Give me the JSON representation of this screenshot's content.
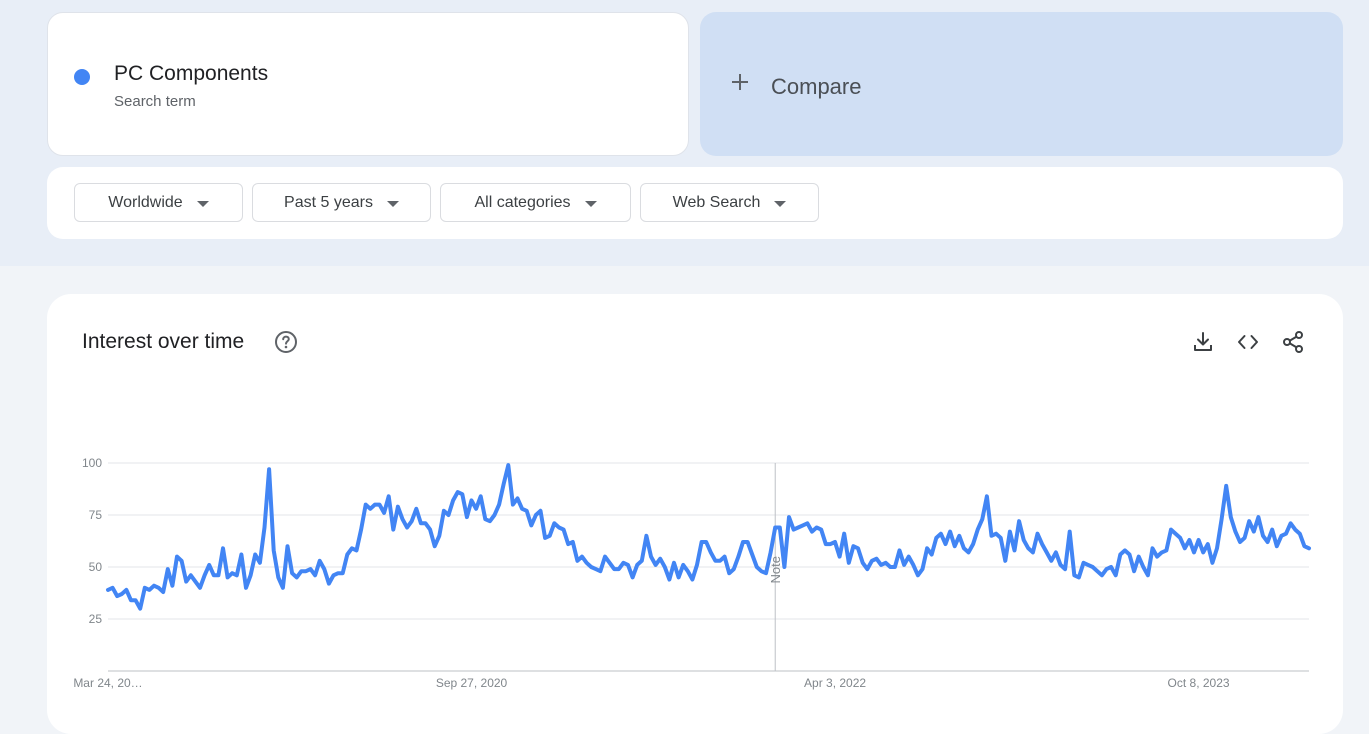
{
  "term": {
    "name": "PC Components",
    "subtitle": "Search term",
    "dot_color": "#4285f4"
  },
  "compare": {
    "label": "Compare",
    "icon": "plus-icon"
  },
  "filters": [
    {
      "label": "Worldwide",
      "icon": "caret-down-icon"
    },
    {
      "label": "Past 5 years",
      "icon": "caret-down-icon"
    },
    {
      "label": "All categories",
      "icon": "caret-down-icon"
    },
    {
      "label": "Web Search",
      "icon": "caret-down-icon"
    }
  ],
  "panel": {
    "title": "Interest over time",
    "icons": [
      "help-icon",
      "download-icon",
      "embed-code-icon",
      "share-icon"
    ]
  },
  "chart_data": {
    "type": "line",
    "series": [
      {
        "color": "#4285f4",
        "values": [
          39,
          40,
          36,
          37,
          39,
          34,
          34,
          30,
          40,
          39,
          41,
          40,
          38,
          49,
          41,
          55,
          53,
          43,
          46,
          43,
          40,
          46,
          51,
          46,
          46,
          59,
          45,
          47,
          46,
          56,
          40,
          46,
          56,
          52,
          69,
          97,
          58,
          45,
          40,
          60,
          47,
          45,
          48,
          48,
          49,
          46,
          53,
          49,
          42,
          46,
          47,
          47,
          56,
          59,
          58,
          68,
          80,
          78,
          80,
          80,
          76,
          84,
          68,
          79,
          73,
          69,
          72,
          78,
          71,
          71,
          68,
          60,
          65,
          77,
          75,
          82,
          86,
          85,
          74,
          82,
          78,
          84,
          73,
          72,
          75,
          80,
          90,
          99,
          80,
          83,
          78,
          77,
          70,
          75,
          77,
          64,
          65,
          71,
          69,
          68,
          61,
          62,
          53,
          55,
          52,
          50,
          49,
          48,
          55,
          52,
          49,
          49,
          52,
          51,
          45,
          51,
          53,
          65,
          55,
          51,
          54,
          50,
          44,
          52,
          45,
          51,
          48,
          44,
          51,
          62,
          62,
          57,
          53,
          53,
          55,
          47,
          49,
          55,
          62,
          62,
          56,
          50,
          48,
          47,
          57,
          69,
          69,
          50,
          74,
          68,
          69,
          70,
          71,
          67,
          69,
          68,
          61,
          61,
          62,
          55,
          66,
          52,
          60,
          59,
          52,
          49,
          53,
          54,
          51,
          52,
          50,
          50,
          58,
          51,
          55,
          51,
          46,
          49,
          59,
          56,
          64,
          66,
          61,
          67,
          60,
          65,
          59,
          57,
          61,
          68,
          73,
          84,
          65,
          66,
          64,
          53,
          67,
          58,
          72,
          63,
          59,
          57,
          66,
          61,
          57,
          53,
          57,
          51,
          49,
          67,
          46,
          45,
          52,
          51,
          50,
          48,
          46,
          49,
          50,
          46,
          56,
          58,
          56,
          48,
          55,
          50,
          46,
          59,
          55,
          57,
          58,
          68,
          66,
          64,
          59,
          63,
          57,
          63,
          57,
          61,
          52,
          59,
          73,
          89,
          74,
          67,
          62,
          64,
          72,
          67,
          74,
          65,
          62,
          68,
          60,
          65,
          66,
          71,
          68,
          66,
          60,
          59
        ]
      }
    ],
    "x_ticks": [
      "Mar 24, 20…",
      "Sep 27, 2020",
      "Apr 3, 2022",
      "Oct 8, 2023"
    ],
    "x_tick_indices": [
      0,
      79,
      158,
      237
    ],
    "y_ticks": [
      "25",
      "50",
      "75",
      "100"
    ],
    "y_tick_values": [
      25,
      50,
      75,
      100
    ],
    "ylim": [
      0,
      100
    ],
    "note_label": "Note",
    "note_index": 145,
    "grid": true
  }
}
